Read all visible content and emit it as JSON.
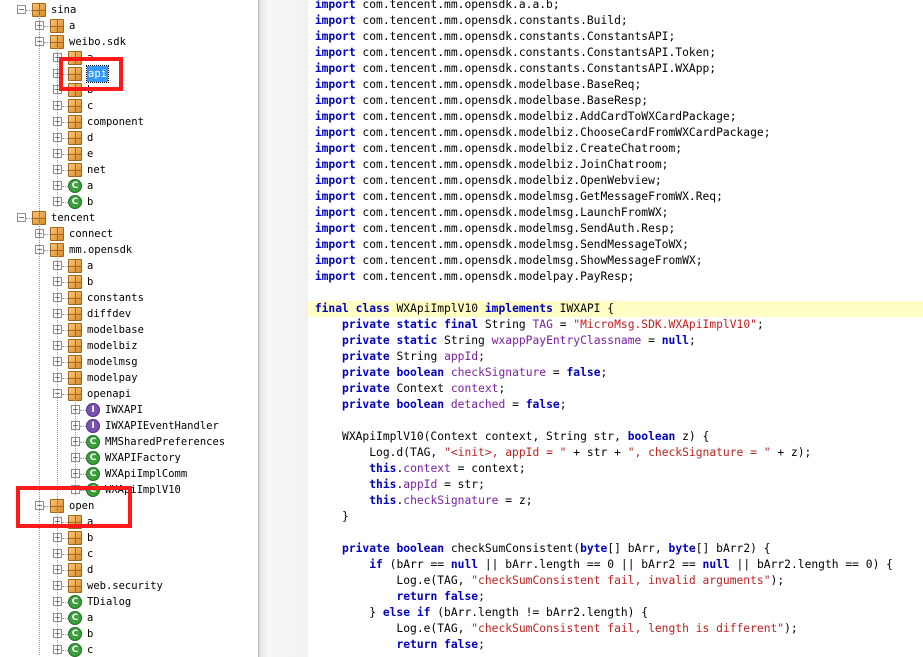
{
  "tree": {
    "items": [
      {
        "label": "sina",
        "type": "pkg",
        "depth": 0,
        "expander": "−"
      },
      {
        "label": "a",
        "type": "pkg",
        "depth": 1,
        "expander": "+"
      },
      {
        "label": "weibo.sdk",
        "type": "pkg",
        "depth": 1,
        "expander": "−"
      },
      {
        "label": "a",
        "type": "pkg",
        "depth": 2,
        "expander": "+"
      },
      {
        "label": "api",
        "type": "pkg",
        "depth": 2,
        "expander": "+",
        "selected": true
      },
      {
        "label": "b",
        "type": "pkg",
        "depth": 2,
        "expander": "+"
      },
      {
        "label": "c",
        "type": "pkg",
        "depth": 2,
        "expander": "+"
      },
      {
        "label": "component",
        "type": "pkg",
        "depth": 2,
        "expander": "+"
      },
      {
        "label": "d",
        "type": "pkg",
        "depth": 2,
        "expander": "+"
      },
      {
        "label": "e",
        "type": "pkg",
        "depth": 2,
        "expander": "+"
      },
      {
        "label": "net",
        "type": "pkg",
        "depth": 2,
        "expander": "+"
      },
      {
        "label": "a",
        "type": "cls",
        "depth": 2,
        "expander": "+"
      },
      {
        "label": "b",
        "type": "cls",
        "depth": 2,
        "expander": "+"
      },
      {
        "label": "tencent",
        "type": "pkg",
        "depth": 0,
        "expander": "−"
      },
      {
        "label": "connect",
        "type": "pkg",
        "depth": 1,
        "expander": "+"
      },
      {
        "label": "mm.opensdk",
        "type": "pkg",
        "depth": 1,
        "expander": "−"
      },
      {
        "label": "a",
        "type": "pkg",
        "depth": 2,
        "expander": "+"
      },
      {
        "label": "b",
        "type": "pkg",
        "depth": 2,
        "expander": "+"
      },
      {
        "label": "constants",
        "type": "pkg",
        "depth": 2,
        "expander": "+"
      },
      {
        "label": "diffdev",
        "type": "pkg",
        "depth": 2,
        "expander": "+"
      },
      {
        "label": "modelbase",
        "type": "pkg",
        "depth": 2,
        "expander": "+"
      },
      {
        "label": "modelbiz",
        "type": "pkg",
        "depth": 2,
        "expander": "+"
      },
      {
        "label": "modelmsg",
        "type": "pkg",
        "depth": 2,
        "expander": "+"
      },
      {
        "label": "modelpay",
        "type": "pkg",
        "depth": 2,
        "expander": "+"
      },
      {
        "label": "openapi",
        "type": "pkg",
        "depth": 2,
        "expander": "−"
      },
      {
        "label": "IWXAPI",
        "type": "intf",
        "depth": 3,
        "expander": "+"
      },
      {
        "label": "IWXAPIEventHandler",
        "type": "intf",
        "depth": 3,
        "expander": "+"
      },
      {
        "label": "MMSharedPreferences",
        "type": "cls",
        "depth": 3,
        "expander": "+"
      },
      {
        "label": "WXAPIFactory",
        "type": "cls",
        "depth": 3,
        "expander": "+"
      },
      {
        "label": "WXApiImplComm",
        "type": "cls",
        "depth": 3,
        "expander": "+"
      },
      {
        "label": "WXApiImplV10",
        "type": "cls",
        "depth": 3,
        "expander": "+"
      },
      {
        "label": "open",
        "type": "pkg",
        "depth": 1,
        "expander": "−"
      },
      {
        "label": "a",
        "type": "pkg",
        "depth": 2,
        "expander": "+"
      },
      {
        "label": "b",
        "type": "pkg",
        "depth": 2,
        "expander": "+"
      },
      {
        "label": "c",
        "type": "pkg",
        "depth": 2,
        "expander": "+"
      },
      {
        "label": "d",
        "type": "pkg",
        "depth": 2,
        "expander": "+"
      },
      {
        "label": "web.security",
        "type": "pkg",
        "depth": 2,
        "expander": "+"
      },
      {
        "label": "TDialog",
        "type": "cls",
        "depth": 2,
        "expander": "+"
      },
      {
        "label": "a",
        "type": "cls",
        "depth": 2,
        "expander": "+"
      },
      {
        "label": "b",
        "type": "cls",
        "depth": 2,
        "expander": "+"
      },
      {
        "label": "c",
        "type": "cls",
        "depth": 2,
        "expander": "+"
      }
    ]
  },
  "code": {
    "highlight_line": 19,
    "lines": [
      [
        [
          "kw",
          "import"
        ],
        [
          "t",
          " com.tencent.mm.opensdk.a.a.b;"
        ]
      ],
      [
        [
          "kw",
          "import"
        ],
        [
          "t",
          " com.tencent.mm.opensdk.constants.Build;"
        ]
      ],
      [
        [
          "kw",
          "import"
        ],
        [
          "t",
          " com.tencent.mm.opensdk.constants.ConstantsAPI;"
        ]
      ],
      [
        [
          "kw",
          "import"
        ],
        [
          "t",
          " com.tencent.mm.opensdk.constants.ConstantsAPI.Token;"
        ]
      ],
      [
        [
          "kw",
          "import"
        ],
        [
          "t",
          " com.tencent.mm.opensdk.constants.ConstantsAPI.WXApp;"
        ]
      ],
      [
        [
          "kw",
          "import"
        ],
        [
          "t",
          " com.tencent.mm.opensdk.modelbase.BaseReq;"
        ]
      ],
      [
        [
          "kw",
          "import"
        ],
        [
          "t",
          " com.tencent.mm.opensdk.modelbase.BaseResp;"
        ]
      ],
      [
        [
          "kw",
          "import"
        ],
        [
          "t",
          " com.tencent.mm.opensdk.modelbiz.AddCardToWXCardPackage;"
        ]
      ],
      [
        [
          "kw",
          "import"
        ],
        [
          "t",
          " com.tencent.mm.opensdk.modelbiz.ChooseCardFromWXCardPackage;"
        ]
      ],
      [
        [
          "kw",
          "import"
        ],
        [
          "t",
          " com.tencent.mm.opensdk.modelbiz.CreateChatroom;"
        ]
      ],
      [
        [
          "kw",
          "import"
        ],
        [
          "t",
          " com.tencent.mm.opensdk.modelbiz.JoinChatroom;"
        ]
      ],
      [
        [
          "kw",
          "import"
        ],
        [
          "t",
          " com.tencent.mm.opensdk.modelbiz.OpenWebview;"
        ]
      ],
      [
        [
          "kw",
          "import"
        ],
        [
          "t",
          " com.tencent.mm.opensdk.modelmsg.GetMessageFromWX.Req;"
        ]
      ],
      [
        [
          "kw",
          "import"
        ],
        [
          "t",
          " com.tencent.mm.opensdk.modelmsg.LaunchFromWX;"
        ]
      ],
      [
        [
          "kw",
          "import"
        ],
        [
          "t",
          " com.tencent.mm.opensdk.modelmsg.SendAuth.Resp;"
        ]
      ],
      [
        [
          "kw",
          "import"
        ],
        [
          "t",
          " com.tencent.mm.opensdk.modelmsg.SendMessageToWX;"
        ]
      ],
      [
        [
          "kw",
          "import"
        ],
        [
          "t",
          " com.tencent.mm.opensdk.modelmsg.ShowMessageFromWX;"
        ]
      ],
      [
        [
          "kw",
          "import"
        ],
        [
          "t",
          " com.tencent.mm.opensdk.modelpay.PayResp;"
        ]
      ],
      [],
      [
        [
          "kw",
          "final class"
        ],
        [
          "t",
          " WXApiImplV10 "
        ],
        [
          "kw",
          "implements"
        ],
        [
          "t",
          " IWXAPI {"
        ]
      ],
      [
        [
          "t",
          "    "
        ],
        [
          "kw",
          "private static final"
        ],
        [
          "t",
          " String "
        ],
        [
          "fld",
          "TAG"
        ],
        [
          "t",
          " = "
        ],
        [
          "str",
          "\"MicroMsg.SDK.WXApiImplV10\""
        ],
        [
          "t",
          ";"
        ]
      ],
      [
        [
          "t",
          "    "
        ],
        [
          "kw",
          "private static"
        ],
        [
          "t",
          " String "
        ],
        [
          "fld",
          "wxappPayEntryClassname"
        ],
        [
          "t",
          " = "
        ],
        [
          "kw",
          "null"
        ],
        [
          "t",
          ";"
        ]
      ],
      [
        [
          "t",
          "    "
        ],
        [
          "kw",
          "private"
        ],
        [
          "t",
          " String "
        ],
        [
          "fld",
          "appId"
        ],
        [
          "t",
          ";"
        ]
      ],
      [
        [
          "t",
          "    "
        ],
        [
          "kw",
          "private boolean"
        ],
        [
          "t",
          " "
        ],
        [
          "fld",
          "checkSignature"
        ],
        [
          "t",
          " = "
        ],
        [
          "kw",
          "false"
        ],
        [
          "t",
          ";"
        ]
      ],
      [
        [
          "t",
          "    "
        ],
        [
          "kw",
          "private"
        ],
        [
          "t",
          " Context "
        ],
        [
          "fld",
          "context"
        ],
        [
          "t",
          ";"
        ]
      ],
      [
        [
          "t",
          "    "
        ],
        [
          "kw",
          "private boolean"
        ],
        [
          "t",
          " "
        ],
        [
          "fld",
          "detached"
        ],
        [
          "t",
          " = "
        ],
        [
          "kw",
          "false"
        ],
        [
          "t",
          ";"
        ]
      ],
      [],
      [
        [
          "t",
          "    WXApiImplV10(Context context, String str, "
        ],
        [
          "kw",
          "boolean"
        ],
        [
          "t",
          " z) {"
        ]
      ],
      [
        [
          "t",
          "        Log.d(TAG, "
        ],
        [
          "str",
          "\"<init>, appId = \""
        ],
        [
          "t",
          " + str + "
        ],
        [
          "str",
          "\", checkSignature = \""
        ],
        [
          "t",
          " + z);"
        ]
      ],
      [
        [
          "t",
          "        "
        ],
        [
          "kw",
          "this"
        ],
        [
          "t",
          "."
        ],
        [
          "fld",
          "context"
        ],
        [
          "t",
          " = context;"
        ]
      ],
      [
        [
          "t",
          "        "
        ],
        [
          "kw",
          "this"
        ],
        [
          "t",
          "."
        ],
        [
          "fld",
          "appId"
        ],
        [
          "t",
          " = str;"
        ]
      ],
      [
        [
          "t",
          "        "
        ],
        [
          "kw",
          "this"
        ],
        [
          "t",
          "."
        ],
        [
          "fld",
          "checkSignature"
        ],
        [
          "t",
          " = z;"
        ]
      ],
      [
        [
          "t",
          "    }"
        ]
      ],
      [],
      [
        [
          "t",
          "    "
        ],
        [
          "kw",
          "private boolean"
        ],
        [
          "t",
          " checkSumConsistent("
        ],
        [
          "kw",
          "byte"
        ],
        [
          "t",
          "[] bArr, "
        ],
        [
          "kw",
          "byte"
        ],
        [
          "t",
          "[] bArr2) {"
        ]
      ],
      [
        [
          "t",
          "        "
        ],
        [
          "kw",
          "if"
        ],
        [
          "t",
          " (bArr == "
        ],
        [
          "kw",
          "null"
        ],
        [
          "t",
          " || bArr.length == 0 || bArr2 == "
        ],
        [
          "kw",
          "null"
        ],
        [
          "t",
          " || bArr2.length == 0) {"
        ]
      ],
      [
        [
          "t",
          "            Log.e(TAG, "
        ],
        [
          "str",
          "\"checkSumConsistent fail, invalid arguments\""
        ],
        [
          "t",
          ");"
        ]
      ],
      [
        [
          "t",
          "            "
        ],
        [
          "kw",
          "return false"
        ],
        [
          "t",
          ";"
        ]
      ],
      [
        [
          "t",
          "        } "
        ],
        [
          "kw",
          "else if"
        ],
        [
          "t",
          " (bArr.length != bArr2.length) {"
        ]
      ],
      [
        [
          "t",
          "            Log.e(TAG, "
        ],
        [
          "str",
          "\"checkSumConsistent fail, length is different\""
        ],
        [
          "t",
          ");"
        ]
      ],
      [
        [
          "t",
          "            "
        ],
        [
          "kw",
          "return false"
        ],
        [
          "t",
          ";"
        ]
      ]
    ]
  }
}
